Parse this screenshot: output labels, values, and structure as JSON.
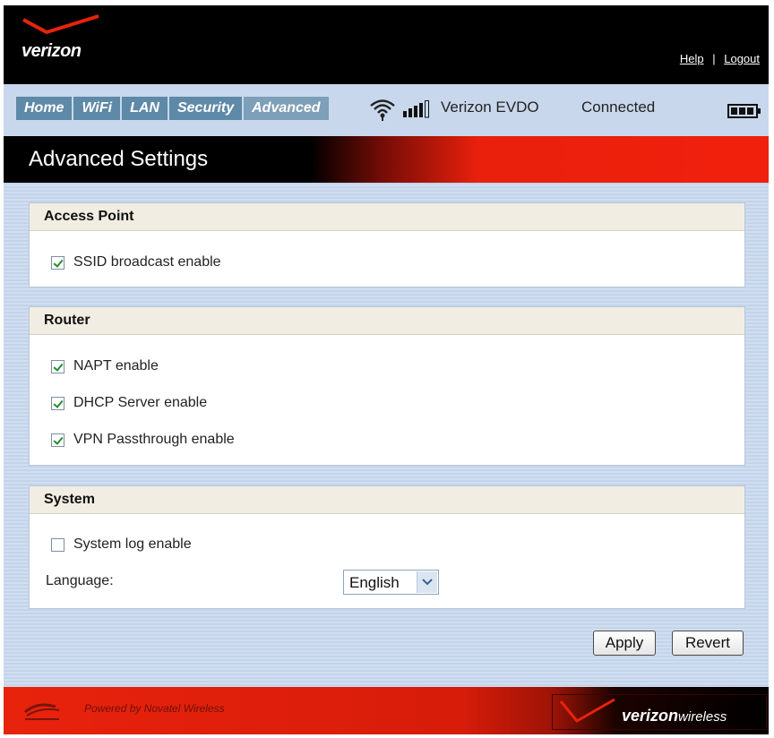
{
  "header": {
    "logo_text": "verizon",
    "links": {
      "help": "Help",
      "separator": "|",
      "logout": "Logout"
    }
  },
  "nav": {
    "tabs": [
      {
        "label": "Home"
      },
      {
        "label": "WiFi"
      },
      {
        "label": "LAN"
      },
      {
        "label": "Security"
      },
      {
        "label": "Advanced",
        "active": true
      }
    ],
    "network": "Verizon  EVDO",
    "connection": "Connected",
    "icons": [
      "wifi-icon",
      "signal-strength-icon",
      "battery-icon"
    ]
  },
  "page": {
    "title": "Advanced Settings"
  },
  "sections": {
    "access_point": {
      "heading": "Access Point",
      "options": [
        {
          "label": "SSID broadcast enable",
          "checked": true
        }
      ]
    },
    "router": {
      "heading": "Router",
      "options": [
        {
          "label": "NAPT enable",
          "checked": true
        },
        {
          "label": "DHCP Server enable",
          "checked": true
        },
        {
          "label": "VPN Passthrough enable",
          "checked": true
        }
      ]
    },
    "system": {
      "heading": "System",
      "options": [
        {
          "label": "System log enable",
          "checked": false
        }
      ],
      "language_label": "Language:",
      "language_value": "English"
    }
  },
  "buttons": {
    "apply": "Apply",
    "revert": "Revert"
  },
  "footer": {
    "powered_by": "Powered by Novatel Wireless",
    "brand_bold": "verizon",
    "brand_light": "wireless"
  },
  "colors": {
    "brand_red": "#e9200c",
    "nav_bg": "#c8d7ec",
    "tab_bg": "#5e89a7",
    "panel_head_bg": "#f1ede2"
  }
}
